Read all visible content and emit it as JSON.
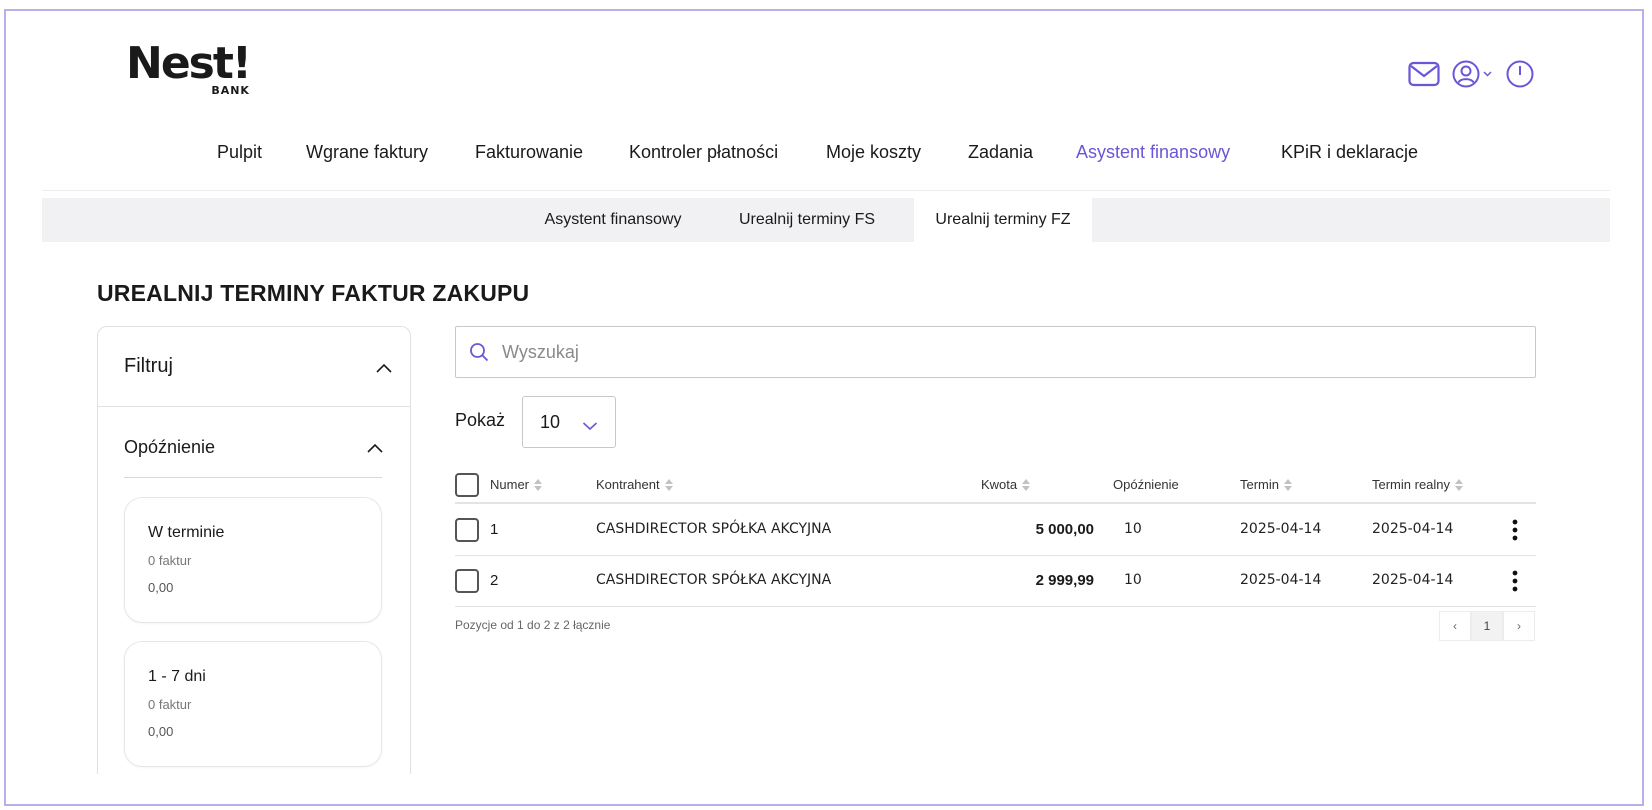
{
  "brand": {
    "name": "Nest!",
    "sub": "BANK"
  },
  "header_icons": [
    "mail-icon",
    "user-circle-icon",
    "chevron-down-icon",
    "power-icon"
  ],
  "main_nav": [
    {
      "label": "Pulpit",
      "active": false
    },
    {
      "label": "Wgrane faktury",
      "active": false
    },
    {
      "label": "Fakturowanie",
      "active": false
    },
    {
      "label": "Kontroler płatności",
      "active": false
    },
    {
      "label": "Moje koszty",
      "active": false
    },
    {
      "label": "Zadania",
      "active": false
    },
    {
      "label": "Asystent finansowy",
      "active": true
    },
    {
      "label": "KPiR i deklaracje",
      "active": false
    }
  ],
  "sub_nav": [
    {
      "label": "Asystent finansowy",
      "active": false
    },
    {
      "label": "Urealnij terminy FS",
      "active": false
    },
    {
      "label": "Urealnij terminy FZ",
      "active": true
    }
  ],
  "page_title": "UREALNIJ TERMINY FAKTUR ZAKUPU",
  "filter": {
    "title": "Filtruj",
    "delay_section": "Opóźnienie",
    "buckets": [
      {
        "title": "W terminie",
        "count": "0 faktur",
        "sum": "0,00"
      },
      {
        "title": "1 - 7 dni",
        "count": "0 faktur",
        "sum": "0,00"
      }
    ]
  },
  "search": {
    "placeholder": "Wyszukaj",
    "value": ""
  },
  "show": {
    "label": "Pokaż",
    "value": "10"
  },
  "table": {
    "columns": [
      "Numer",
      "Kontrahent",
      "Kwota",
      "Opóźnienie",
      "Termin",
      "Termin realny"
    ],
    "rows": [
      {
        "numer": "1",
        "kontrahent": "CASHDIRECTOR SPÓŁKA AKCYJNA",
        "kwota": "5 000,00",
        "opoznienie": "10",
        "termin": "2025-04-14",
        "termin_realny": "2025-04-14"
      },
      {
        "numer": "2",
        "kontrahent": "CASHDIRECTOR SPÓŁKA AKCYJNA",
        "kwota": "2 999,99",
        "opoznienie": "10",
        "termin": "2025-04-14",
        "termin_realny": "2025-04-14"
      }
    ],
    "footer": "Pozycje od 1 do 2 z 2 łącznie"
  },
  "pagination": {
    "prev": "‹",
    "current": "1",
    "next": "›"
  },
  "colors": {
    "accent": "#6c55d6",
    "frame": "#b9b0ea",
    "subnav_bg": "#f1f1f3"
  }
}
